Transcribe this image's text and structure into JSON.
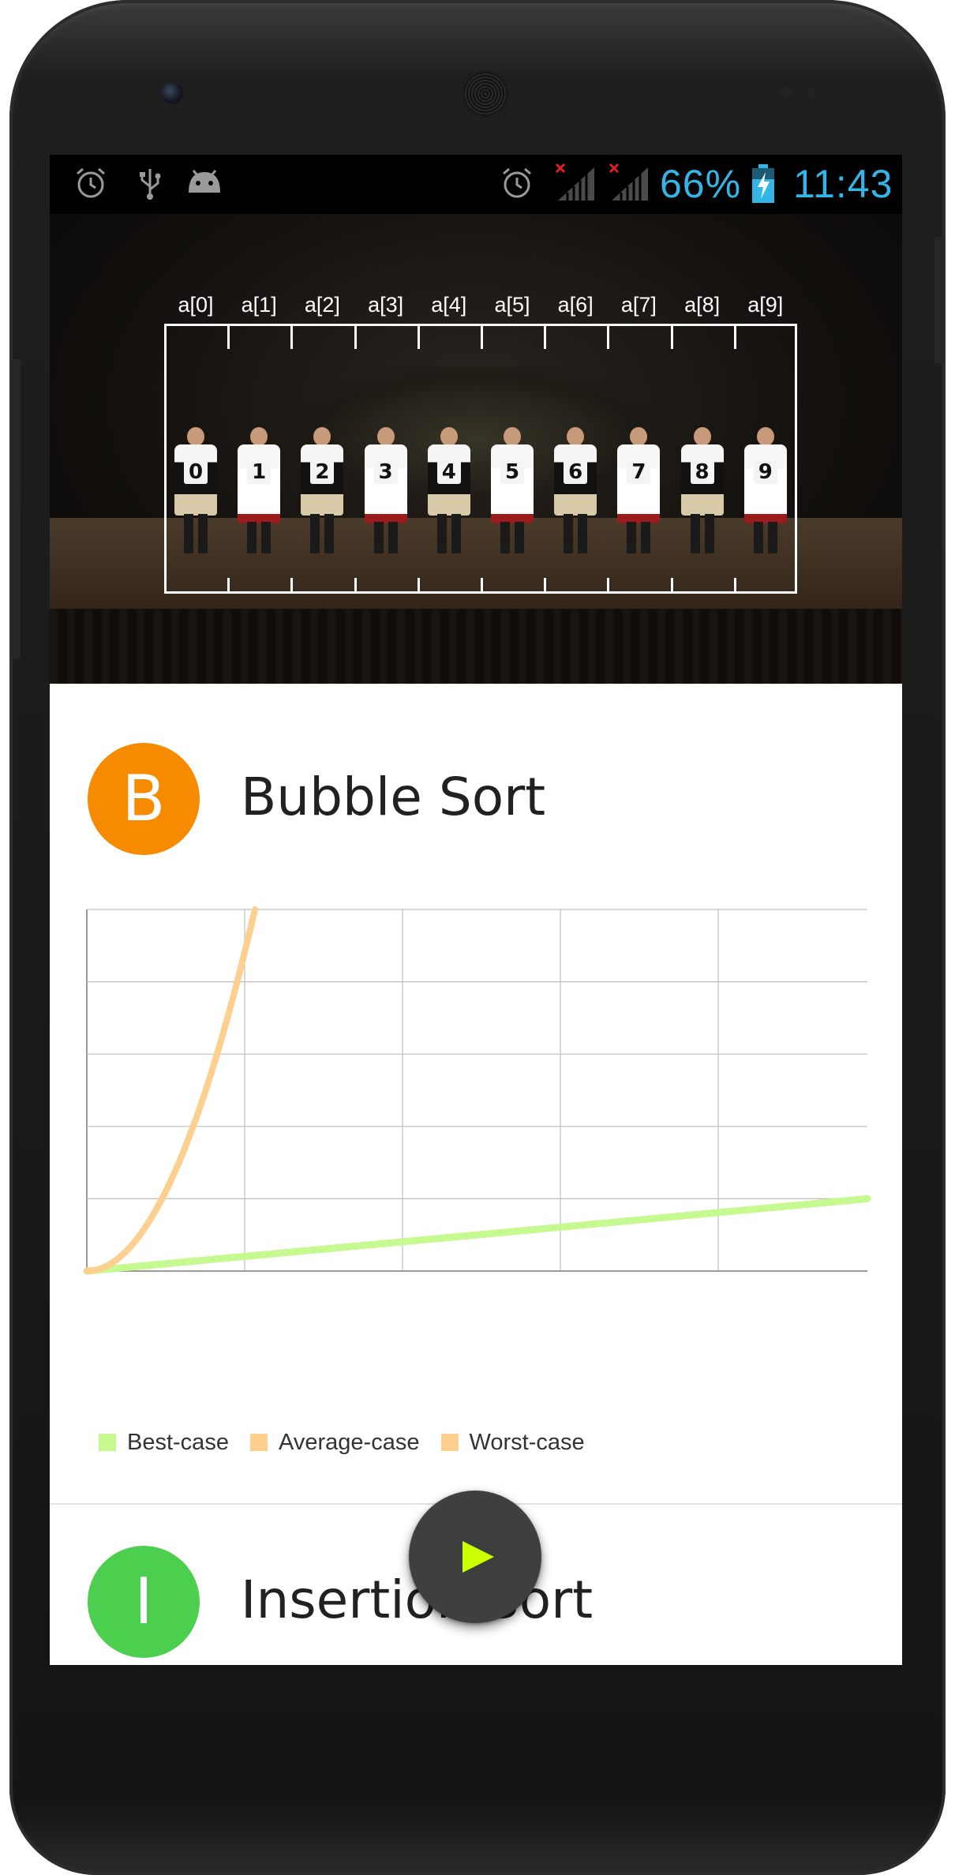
{
  "status_bar": {
    "battery": "66%",
    "time": "11:43",
    "left_icons": [
      "alarm-icon",
      "usb-icon",
      "android-debug-icon"
    ],
    "right_icons": [
      "alarm-icon",
      "signal-no-service-icon",
      "signal-no-service-icon",
      "battery-charging-icon"
    ]
  },
  "video": {
    "indices": [
      "a[0]",
      "a[1]",
      "a[2]",
      "a[3]",
      "a[4]",
      "a[5]",
      "a[6]",
      "a[7]",
      "a[8]",
      "a[9]"
    ],
    "dancer_numbers": [
      "0",
      "1",
      "2",
      "3",
      "4",
      "5",
      "6",
      "7",
      "8",
      "9"
    ]
  },
  "cards": [
    {
      "letter": "B",
      "title": "Bubble Sort",
      "avatar_color": "#f68b00"
    },
    {
      "letter": "I",
      "title": "Insertion Sort",
      "avatar_color": "#4cce4f"
    }
  ],
  "chart_data": {
    "type": "line",
    "grid": true,
    "legend_placement": "bottom-left",
    "series": [
      {
        "name": "Best-case",
        "color": "#c6f98f",
        "growth": "linear"
      },
      {
        "name": "Average-case",
        "color": "#fdd08f",
        "growth": "quadratic"
      },
      {
        "name": "Worst-case",
        "color": "#fdd08f",
        "growth": "quadratic"
      }
    ]
  },
  "fab": {
    "icon": "play-icon",
    "icon_color": "#ccff00"
  },
  "colors": {
    "status_text": "#33b5e5",
    "fab_bg": "#3f3f3f"
  }
}
